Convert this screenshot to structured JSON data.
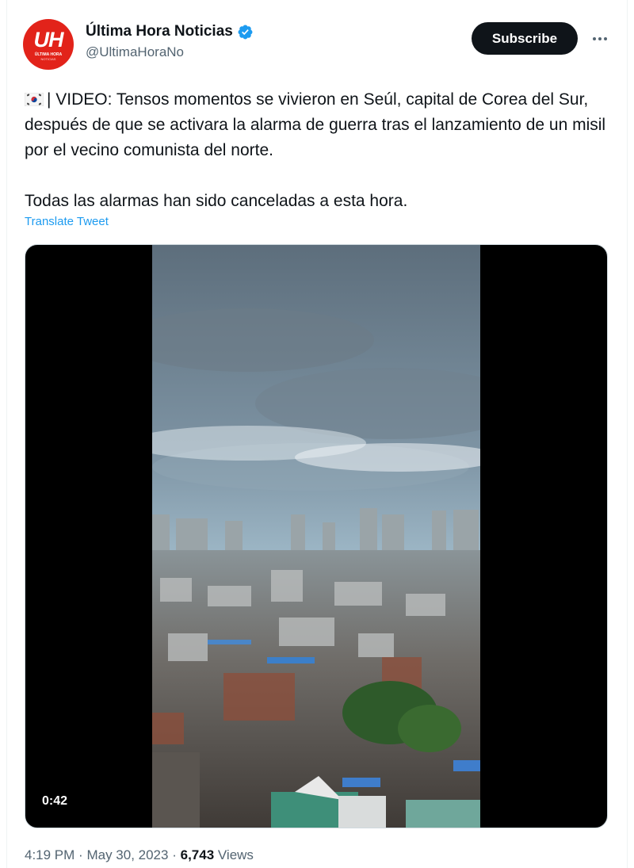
{
  "account": {
    "avatar_text": "UH",
    "avatar_subtext": "ÚLTIMA HORA",
    "avatar_subtext2": "NOTICIAS",
    "display_name": "Última Hora Noticias",
    "handle": "@UltimaHoraNo",
    "verified": true
  },
  "actions": {
    "subscribe_label": "Subscribe",
    "more_icon": "more-horizontal-icon"
  },
  "tweet": {
    "flag_icon": "south-korea-flag-icon",
    "paragraph1": "| VIDEO: Tensos momentos se vivieron en Seúl, capital de Corea del Sur, después de que se activara la alarma de guerra tras el lanzamiento de un misil por el vecino comunista del norte.",
    "paragraph2": "Todas las alarmas han sido canceladas a esta hora.",
    "translate_label": "Translate Tweet"
  },
  "media": {
    "type": "video",
    "duration": "0:42"
  },
  "footer": {
    "time": "4:19 PM",
    "separator": "·",
    "date": "May 30, 2023",
    "views_count": "6,743",
    "views_label": "Views"
  },
  "colors": {
    "accent": "#1d9bf0",
    "verified_badge": "#1d9bf0",
    "brand_red": "#e2231a"
  }
}
